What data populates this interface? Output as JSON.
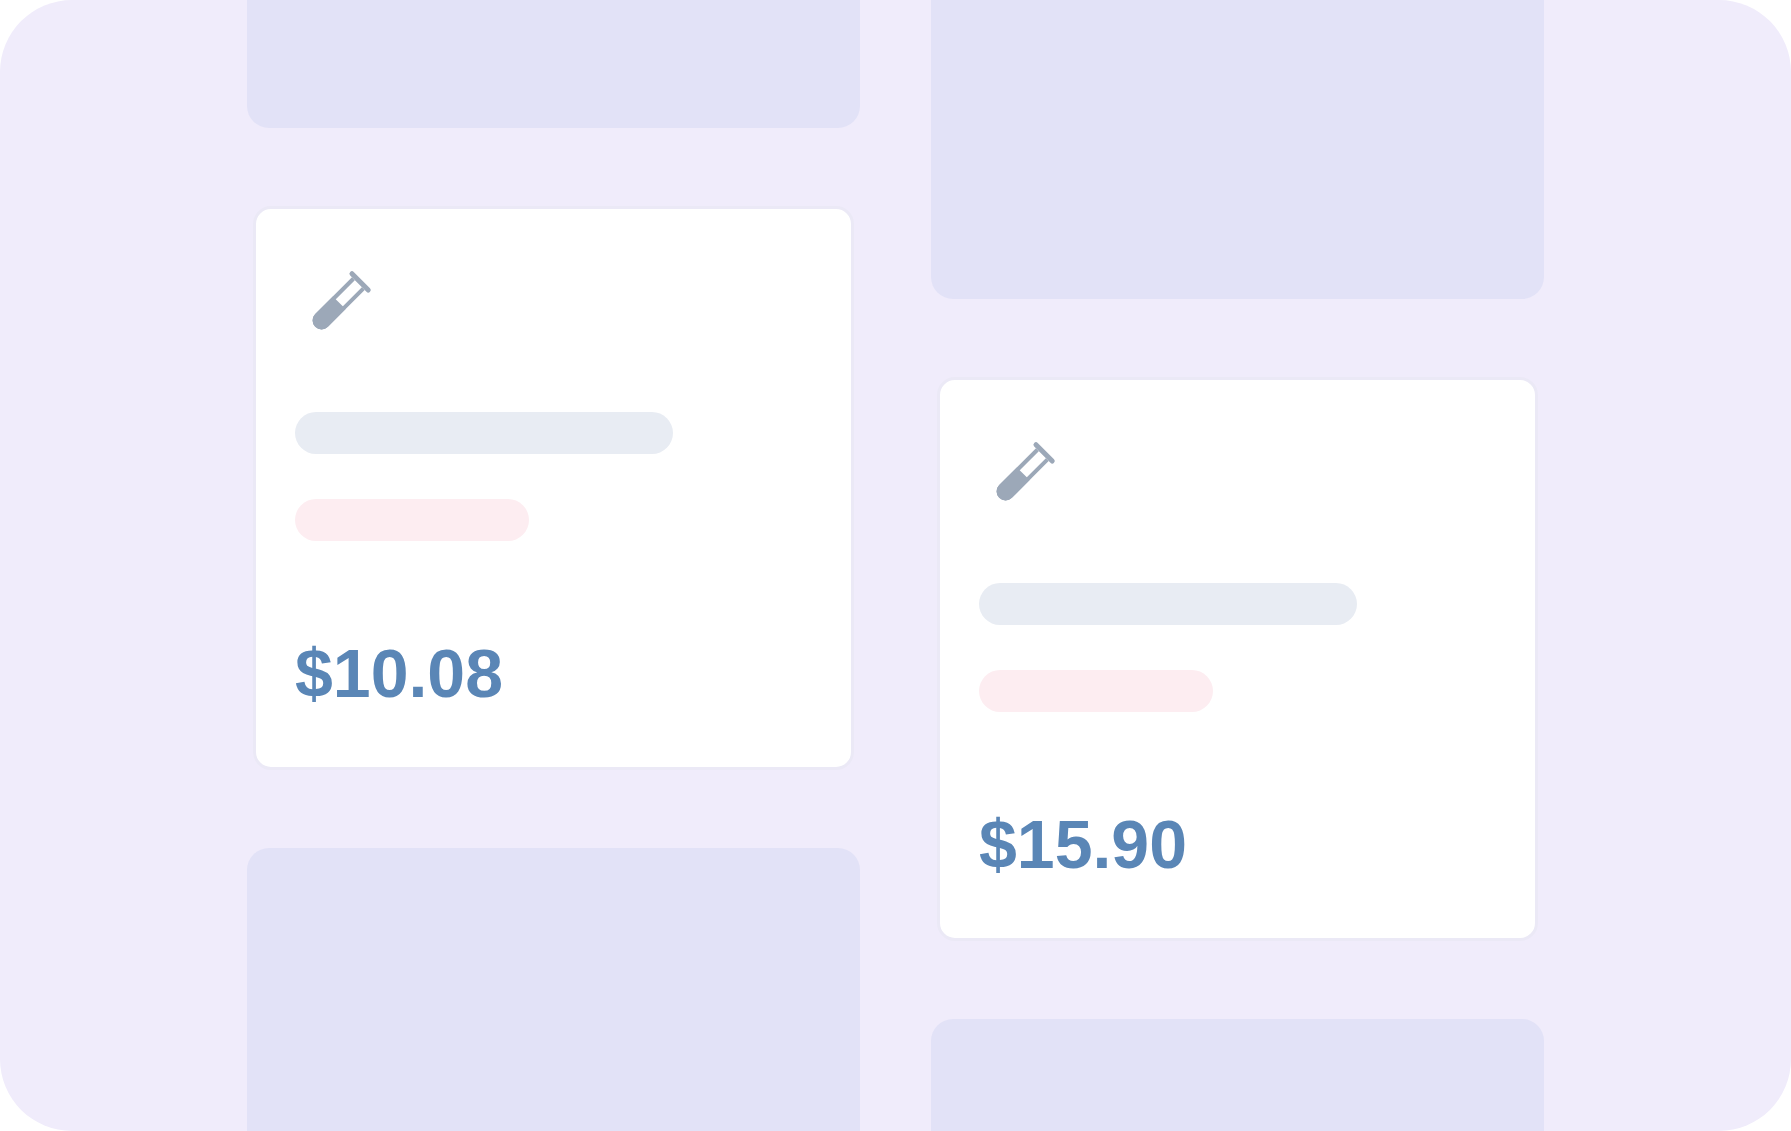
{
  "columns": [
    {
      "items": [
        {
          "kind": "placeholder"
        },
        {
          "kind": "product",
          "price": "$10.08"
        },
        {
          "kind": "placeholder"
        }
      ]
    },
    {
      "items": [
        {
          "kind": "placeholder"
        },
        {
          "kind": "product",
          "price": "$15.90"
        },
        {
          "kind": "placeholder"
        }
      ]
    }
  ]
}
